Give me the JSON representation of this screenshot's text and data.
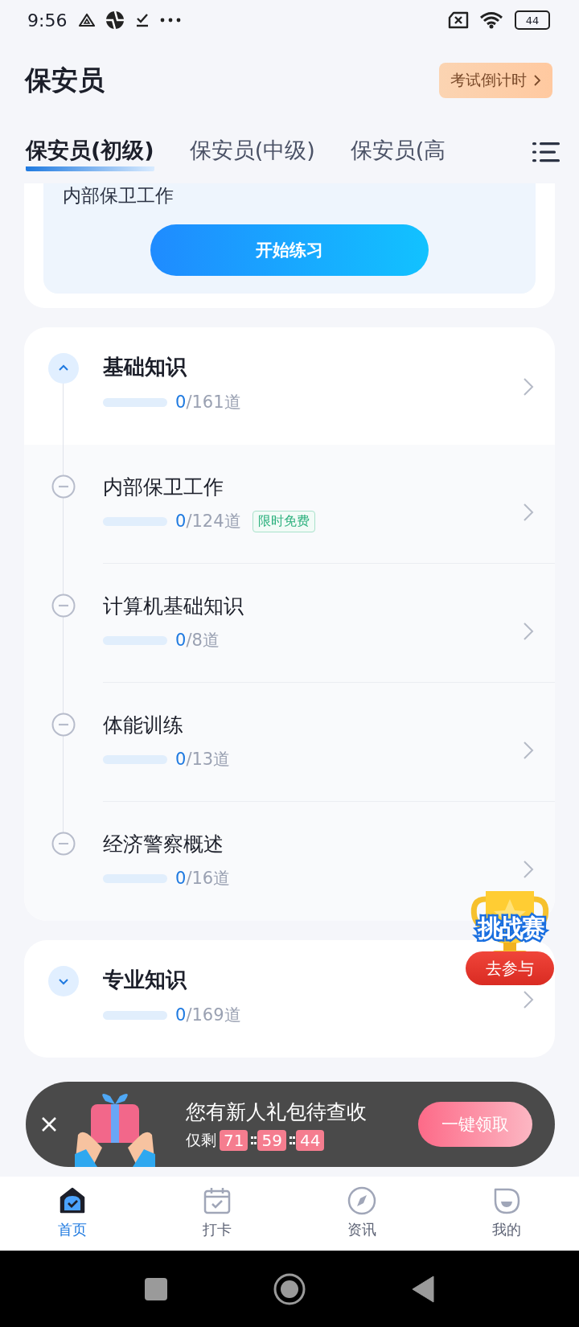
{
  "status_bar": {
    "time": "9:56",
    "battery": "44"
  },
  "header": {
    "title": "保安员",
    "countdown_button": "考试倒计时"
  },
  "tabs": [
    {
      "label": "保安员(初级)",
      "selected": true
    },
    {
      "label": "保安员(中级)",
      "selected": false
    },
    {
      "label": "保安员(高",
      "selected": false
    }
  ],
  "practice_card": {
    "subtitle": "内部保卫工作",
    "button": "开始练习"
  },
  "sections": [
    {
      "title": "基础知识",
      "expanded": true,
      "done": "0",
      "total": "/161道",
      "level": 0,
      "items": [
        {
          "title": "内部保卫工作",
          "done": "0",
          "total": "/124道",
          "level": 0,
          "badge": "限时免费"
        },
        {
          "title": "计算机基础知识",
          "done": "0",
          "total": "/8道",
          "level": 0
        },
        {
          "title": "体能训练",
          "done": "0",
          "total": "/13道",
          "level": 0
        },
        {
          "title": "经济警察概述",
          "done": "0",
          "total": "/16道",
          "level": 0
        }
      ]
    },
    {
      "title": "专业知识",
      "expanded": false,
      "done": "0",
      "total": "/169道",
      "level": 0
    }
  ],
  "challenge_badge": {
    "title": "挑战赛",
    "button": "去参与"
  },
  "gift_banner": {
    "title": "您有新人礼包待查收",
    "remaining_label": "仅剩",
    "countdown": [
      "71",
      "59",
      "44"
    ],
    "button": "一键领取"
  },
  "bottom_nav": [
    {
      "label": "首页",
      "selected": true
    },
    {
      "label": "打卡",
      "selected": false
    },
    {
      "label": "资讯",
      "selected": false
    },
    {
      "label": "我的",
      "selected": false
    }
  ]
}
